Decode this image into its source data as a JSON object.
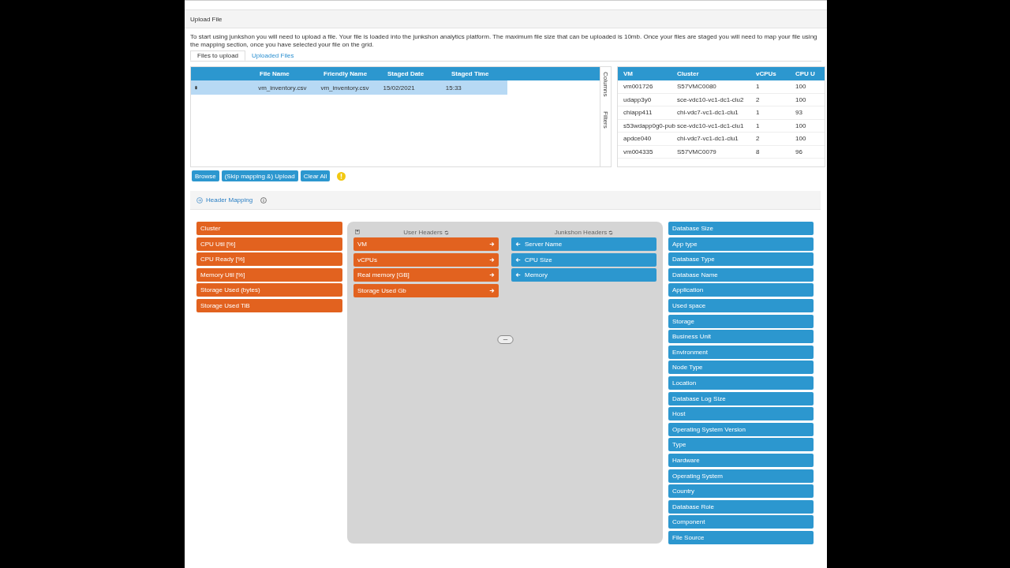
{
  "panel_title": "Upload File",
  "description": "To start using junkshon you will need to upload a file. Your file is loaded into the junkshon analytics platform. The maximum file size that can be uploaded is 10mb. Once your files are staged you will need to map your file using the mapping section, once you have selected your file on the grid.",
  "tabs": [
    {
      "label": "Files to upload",
      "selected": true
    },
    {
      "label": "Uploaded Files",
      "selected": false
    }
  ],
  "files_grid": {
    "columns": [
      "File Name",
      "Friendly Name",
      "Staged Date",
      "Staged Time"
    ],
    "rows": [
      {
        "cells": [
          "vm_inventory.csv",
          "vm_inventory.csv",
          "15/02/2021",
          "15:33"
        ],
        "selected": true
      }
    ],
    "side_buttons": [
      "Columns",
      "Filters"
    ]
  },
  "preview_grid": {
    "columns": [
      "VM",
      "Cluster",
      "vCPUs",
      "CPU U"
    ],
    "rows": [
      [
        "vm001726",
        "S57VMC0080",
        "1",
        "100"
      ],
      [
        "udapp3y0",
        "sce-vdc10-vc1-dc1-clu2",
        "2",
        "100"
      ],
      [
        "chiapp411",
        "chi-vdc7-vc1-dc1-clu1",
        "1",
        "93"
      ],
      [
        "s53wdapp0g0-pub",
        "sce-vdc10-vc1-dc1-clu1",
        "1",
        "100"
      ],
      [
        "apdce040",
        "chi-vdc7-vc1-dc1-clu1",
        "2",
        "100"
      ],
      [
        "vm004335",
        "S57VMC0079",
        "8",
        "96"
      ]
    ]
  },
  "buttons": [
    "Browse",
    "(Skip mapping &) Upload",
    "Clear All"
  ],
  "mapping": {
    "title": "Header Mapping",
    "unmapped_user_headers": [
      "Cluster",
      "CPU Util [%]",
      "CPU Ready [%]",
      "Memory Util [%]",
      "Storage Used (bytes)",
      "Storage Used TiB"
    ],
    "user_headers_title": "User Headers",
    "junkshon_headers_title": "Junkshon Headers",
    "pairs": [
      {
        "user": "VM",
        "junkshon": "Server Name"
      },
      {
        "user": "vCPUs",
        "junkshon": "CPU Size"
      },
      {
        "user": "Real memory [GB]",
        "junkshon": "Memory"
      },
      {
        "user": "Storage Used Gb"
      }
    ],
    "available_junkshon_headers": [
      "Database Size",
      "App type",
      "Database Type",
      "Database Name",
      "Application",
      "Used space",
      "Storage",
      "Business Unit",
      "Environment",
      "Node Type",
      "Location",
      "Database Log Size",
      "Host",
      "Operating System Version",
      "Type",
      "Hardware",
      "Operating System",
      "Country",
      "Database Role",
      "Component",
      "File Source"
    ]
  }
}
